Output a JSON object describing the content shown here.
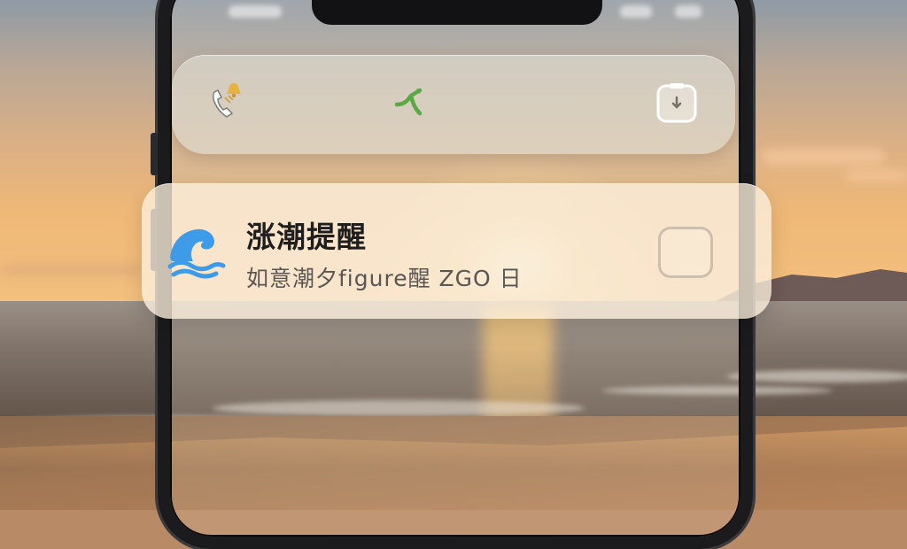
{
  "action_bar": {
    "call_icon": "phone-with-bell-icon",
    "share_icon": "share-icon",
    "dismiss_icon": "download-box-icon"
  },
  "notification": {
    "app_icon": "wave-icon",
    "title": "涨潮提醒",
    "body": "如意潮夕figure醒 ZGO 日",
    "checkbox_checked": false
  },
  "colors": {
    "wave_blue": "#3e9be8",
    "share_green": "#5aa845",
    "bell_gold": "#e6b340"
  }
}
